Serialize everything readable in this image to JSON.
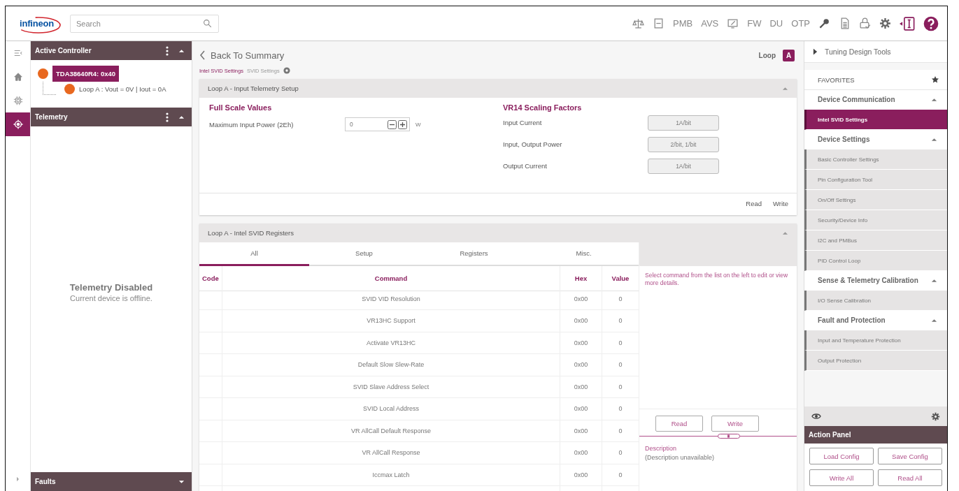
{
  "header": {
    "logo": "infineon",
    "search": {
      "placeholder": "Search"
    },
    "toolbar": [
      {
        "kind": "icon"
      },
      {
        "kind": "icon"
      },
      {
        "kind": "text",
        "label": "PMB"
      },
      {
        "kind": "text",
        "label": "AVS"
      },
      {
        "kind": "icon"
      },
      {
        "kind": "text",
        "label": "FW"
      },
      {
        "kind": "text",
        "label": "DU"
      },
      {
        "kind": "text",
        "label": "OTP"
      },
      {
        "kind": "icon"
      },
      {
        "kind": "icon"
      },
      {
        "kind": "icon"
      },
      {
        "kind": "icon"
      },
      {
        "kind": "icon"
      },
      {
        "kind": "icon"
      }
    ]
  },
  "rail": {
    "items": [
      {
        "selected": false
      },
      {
        "selected": false
      },
      {
        "selected": false
      },
      {
        "selected": true
      }
    ]
  },
  "left": {
    "active_controller": {
      "title": "Active Controller",
      "expanded": true,
      "device": {
        "label": "TDA38640R4: 0x40",
        "selected": true
      },
      "loop": "Loop A : Vout = 0V | Iout = 0A"
    },
    "telemetry": {
      "title": "Telemetry",
      "expanded": true,
      "status_title": "Telemetry Disabled",
      "status_text": "Current device is offline."
    },
    "faults": {
      "title": "Faults",
      "expanded": false
    }
  },
  "main": {
    "back": "Back To Summary",
    "breadcrumb": [
      "Intel SVID Settings",
      "SVID Settings"
    ],
    "loop": {
      "label": "Loop",
      "value": "A"
    },
    "telemetry_setup": {
      "title": "Loop A - Input Telemetry Setup",
      "expanded": true,
      "full_scale": {
        "heading": "Full Scale Values",
        "label": "Maximum Input Power (2Eh)",
        "value": "0",
        "unit": "W"
      },
      "scaling": {
        "heading": "VR14 Scaling Factors",
        "rows": [
          {
            "label": "Input Current",
            "value": "1A/bit"
          },
          {
            "label": "Input, Output Power",
            "value": "2/bit, 1/bit"
          },
          {
            "label": "Output Current",
            "value": "1A/bit"
          }
        ]
      },
      "actions": [
        "Read",
        "Write"
      ]
    },
    "registers": {
      "title": "Loop A - Intel SVID Registers",
      "expanded": true,
      "tabs": [
        {
          "label": "All",
          "selected": true
        },
        {
          "label": "Setup",
          "selected": false
        },
        {
          "label": "Registers",
          "selected": false
        },
        {
          "label": "Misc.",
          "selected": false
        }
      ],
      "columns": [
        "Code",
        "Command",
        "Hex",
        "Value"
      ],
      "rows": [
        {
          "command": "SVID VID Resolution",
          "hex": "0x00",
          "value": "0"
        },
        {
          "command": "VR13HC Support",
          "hex": "0x00",
          "value": "0"
        },
        {
          "command": "Activate VR13HC",
          "hex": "0x00",
          "value": "0"
        },
        {
          "command": "Default Slow Slew-Rate",
          "hex": "0x00",
          "value": "0"
        },
        {
          "command": "SVID Slave Address Select",
          "hex": "0x00",
          "value": "0"
        },
        {
          "command": "SVID Local Address",
          "hex": "0x00",
          "value": "0"
        },
        {
          "command": "VR AllCall Default Response",
          "hex": "0x00",
          "value": "0"
        },
        {
          "command": "VR AllCall Response",
          "hex": "0x00",
          "value": "0"
        },
        {
          "command": "Iccmax Latch",
          "hex": "0x00",
          "value": "0"
        }
      ],
      "hint": "Select command from the list on the left to edit or view more details.",
      "buttons": [
        "Read",
        "Write"
      ],
      "description_label": "Description",
      "description": "(Description unavailable)"
    }
  },
  "right": {
    "tuning": "Tuning Design Tools",
    "favorites": "FAVORITES",
    "groups": [
      {
        "title": "Device Communication",
        "expanded": true,
        "items": [
          {
            "label": "Intel SVID Settings",
            "selected": true
          }
        ]
      },
      {
        "title": "Device Settings",
        "expanded": true,
        "items": [
          {
            "label": "Basic Controller Settings",
            "selected": false
          },
          {
            "label": "Pin Configuration Tool",
            "selected": false
          },
          {
            "label": "On/Off Settings",
            "selected": false
          },
          {
            "label": "Security/Device Info",
            "selected": false
          },
          {
            "label": "I2C and PMBus",
            "selected": false
          },
          {
            "label": "PID Control Loop",
            "selected": false
          }
        ]
      },
      {
        "title": "Sense & Telemetry Calibration",
        "expanded": true,
        "items": [
          {
            "label": "I/O Sense Calibration",
            "selected": false
          }
        ]
      },
      {
        "title": "Fault and Protection",
        "expanded": true,
        "items": [
          {
            "label": "Input and Temperature Protection",
            "selected": false
          },
          {
            "label": "Output Protection",
            "selected": false
          }
        ]
      }
    ],
    "action_panel": {
      "title": "Action Panel",
      "buttons": [
        "Load Config",
        "Save Config",
        "Write All",
        "Read All"
      ]
    }
  }
}
